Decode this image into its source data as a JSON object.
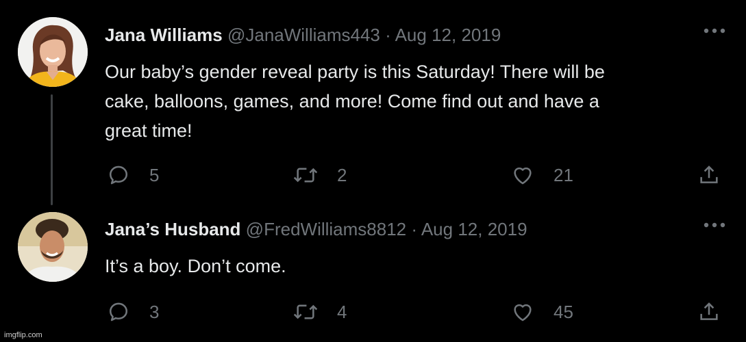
{
  "tweets": [
    {
      "name": "Jana Williams",
      "handle": "@JanaWilliams443",
      "separator": "·",
      "date": "Aug 12, 2019",
      "text": "Our baby’s gender reveal party is this Saturday!  There will be\ncake, balloons, games, and more!  Come find out and have a\ngreat time!",
      "replies": "5",
      "retweets": "2",
      "likes": "21",
      "avatar_icon": "woman-avatar-photo"
    },
    {
      "name": "Jana’s Husband",
      "handle": "@FredWilliams8812",
      "separator": "·",
      "date": "Aug 12, 2019",
      "text": "It’s a boy.  Don’t come.",
      "replies": "3",
      "retweets": "4",
      "likes": "45",
      "avatar_icon": "man-avatar-photo"
    }
  ],
  "watermark": "imgflip.com",
  "colors": {
    "background": "#000000",
    "text": "#e7e9ea",
    "muted": "#71767b",
    "thread_line": "#3d4043"
  }
}
